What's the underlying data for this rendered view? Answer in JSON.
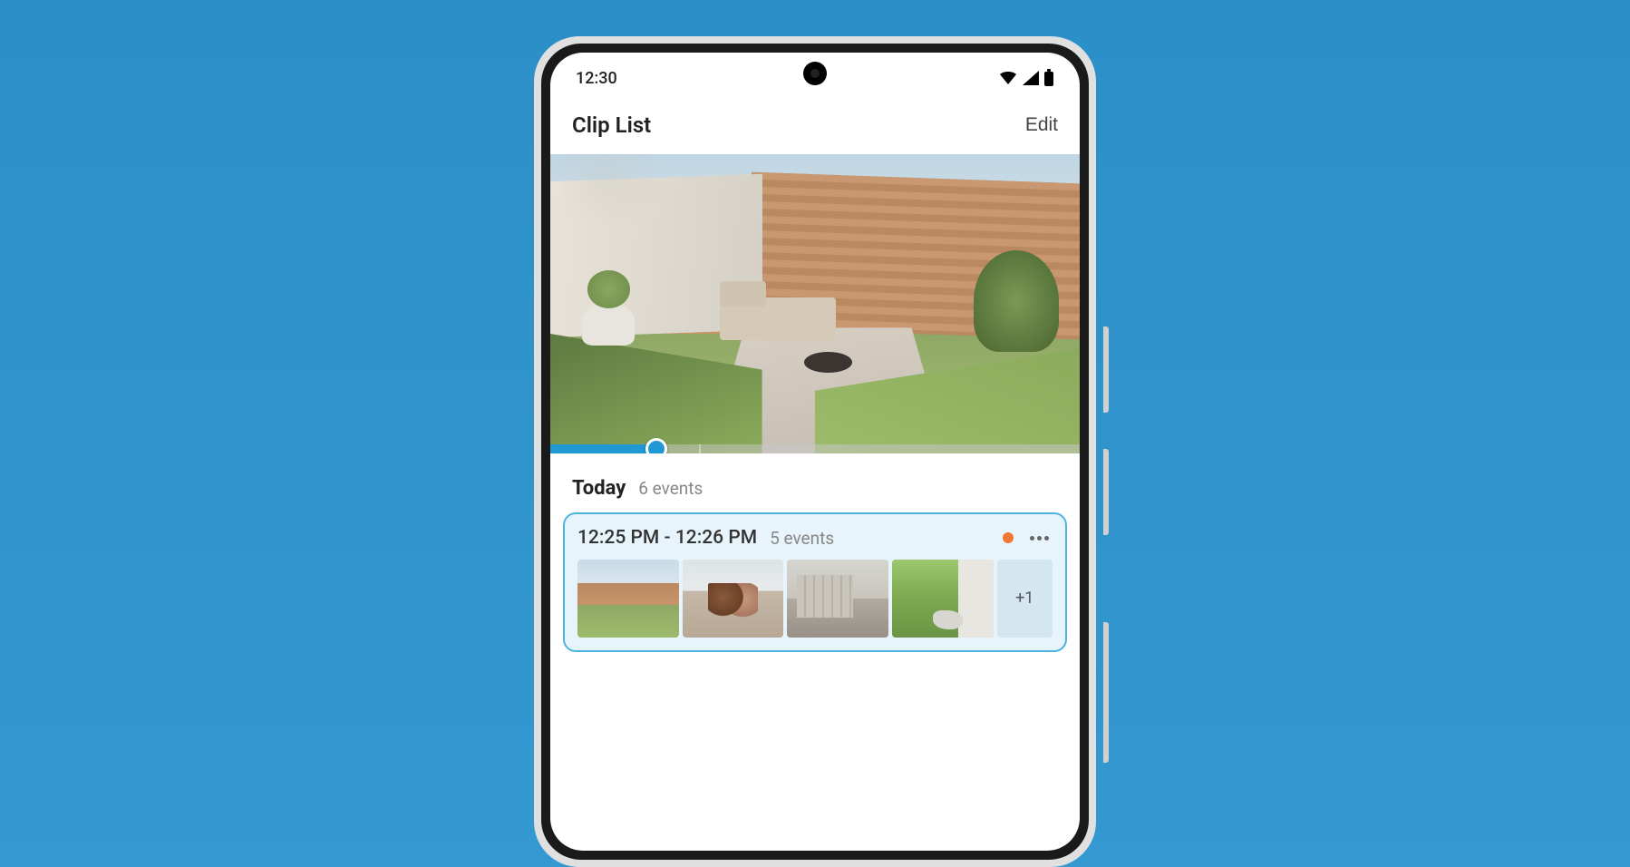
{
  "status": {
    "time": "12:30"
  },
  "header": {
    "title": "Clip List",
    "edit_label": "Edit"
  },
  "scrubber": {
    "progress_percent": 20
  },
  "section": {
    "title": "Today",
    "count": "6 events"
  },
  "event": {
    "time_range": "12:25 PM - 12:26 PM",
    "count": "5 events",
    "status_color": "#ed7733",
    "overflow_label": "+1",
    "thumb_count": 4
  }
}
